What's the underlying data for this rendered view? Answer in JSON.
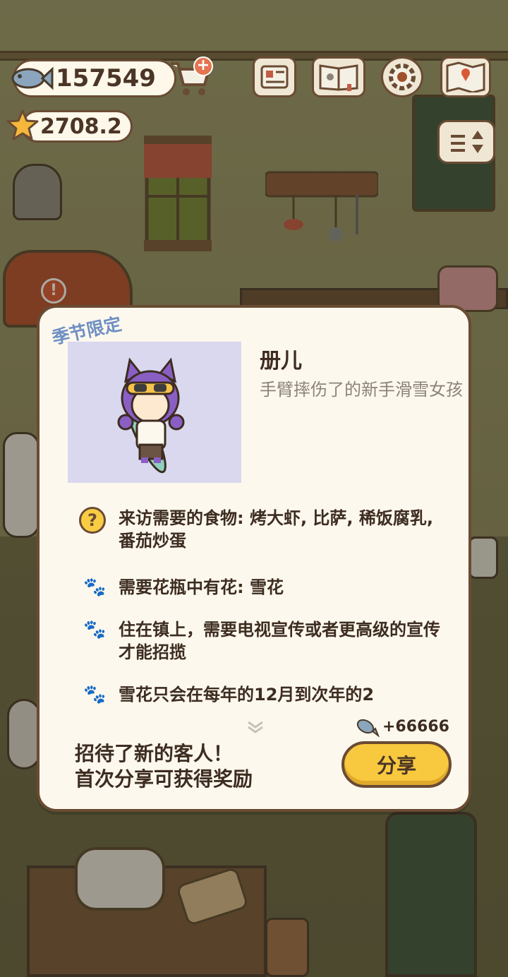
{
  "hud": {
    "fish_count": "157549",
    "star_count": "2708.2"
  },
  "colors": {
    "accent_yellow": "#f8c93f",
    "outline_brown": "#6a4b33",
    "panel_cream": "#fdf8ee",
    "seasonal_blue": "#6e8fc4"
  },
  "icons": [
    "fish-icon",
    "star-icon",
    "cart-icon",
    "plus-icon",
    "newspaper-icon",
    "book-icon",
    "gear-icon",
    "map-icon",
    "toggle-icon",
    "question-icon",
    "paw-icon",
    "chevron-down-icon"
  ],
  "guest_card": {
    "seasonal_tag": "季节限定",
    "name": "册儿",
    "description": "手臂摔伤了的新手滑雪女孩",
    "requirements": [
      {
        "icon": "question-icon",
        "text": "来访需要的食物: 烤大虾, 比萨, 稀饭腐乳, 番茄炒蛋"
      },
      {
        "icon": "paw-icon",
        "text": "需要花瓶中有花: 雪花"
      },
      {
        "icon": "paw-icon",
        "text": "住在镇上，需要电视宣传或者更高级的宣传才能招揽"
      },
      {
        "icon": "paw-icon",
        "text": "雪花只会在每年的12月到次年的2"
      }
    ],
    "reward": "+66666",
    "notice_line1": "招待了新的客人！",
    "notice_line2": "首次分享可获得奖励",
    "share_label": "分享"
  }
}
